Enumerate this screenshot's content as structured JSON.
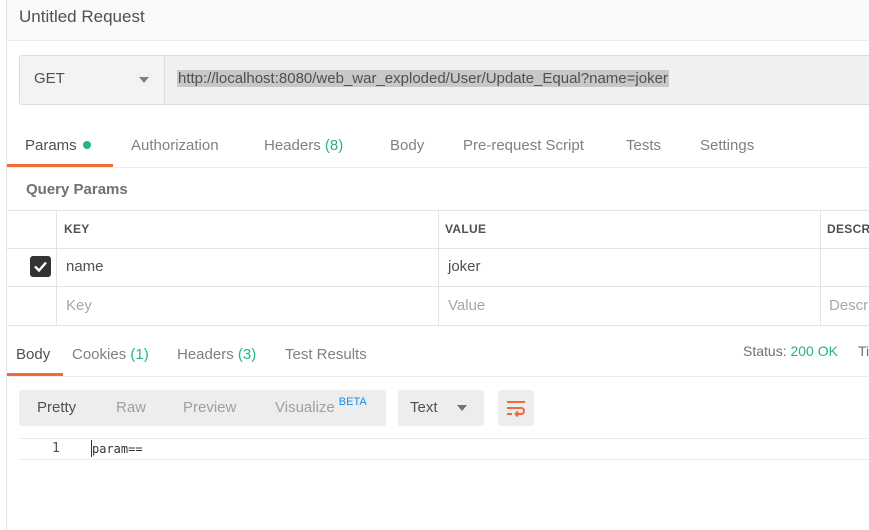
{
  "request": {
    "title": "Untitled Request"
  },
  "url_bar": {
    "method": "GET",
    "url": "http://localhost:8080/web_war_exploded/User/Update_Equal?name=joker"
  },
  "request_tabs": {
    "params": "Params",
    "authorization": "Authorization",
    "headers": "Headers",
    "headers_count": "(8)",
    "body": "Body",
    "prerequest": "Pre-request Script",
    "tests": "Tests",
    "settings": "Settings"
  },
  "query_params": {
    "title": "Query Params",
    "columns": {
      "key": "KEY",
      "value": "VALUE",
      "description": "DESCRI"
    },
    "rows": [
      {
        "checked": true,
        "key": "name",
        "value": "joker"
      }
    ],
    "placeholders": {
      "key": "Key",
      "value": "Value",
      "description": "Descr"
    }
  },
  "response_tabs": {
    "body": "Body",
    "cookies": "Cookies",
    "cookies_count": "(1)",
    "headers": "Headers",
    "headers_count": "(3)",
    "test_results": "Test Results"
  },
  "status": {
    "label": "Status:",
    "value": "200 OK",
    "time_label": "Ti"
  },
  "view_modes": {
    "pretty": "Pretty",
    "raw": "Raw",
    "preview": "Preview",
    "visualize": "Visualize",
    "beta": "BETA"
  },
  "format": {
    "selected": "Text"
  },
  "editor": {
    "line_number": "1",
    "content": "param=="
  },
  "colors": {
    "accent": "#f26b3a",
    "success": "#26b47f",
    "beta": "#1b8ae8"
  },
  "icons": {
    "method_dropdown": "chevron-down-icon",
    "format_dropdown": "chevron-down-icon",
    "wrap": "wrap-lines-icon",
    "checkbox": "check-icon"
  }
}
